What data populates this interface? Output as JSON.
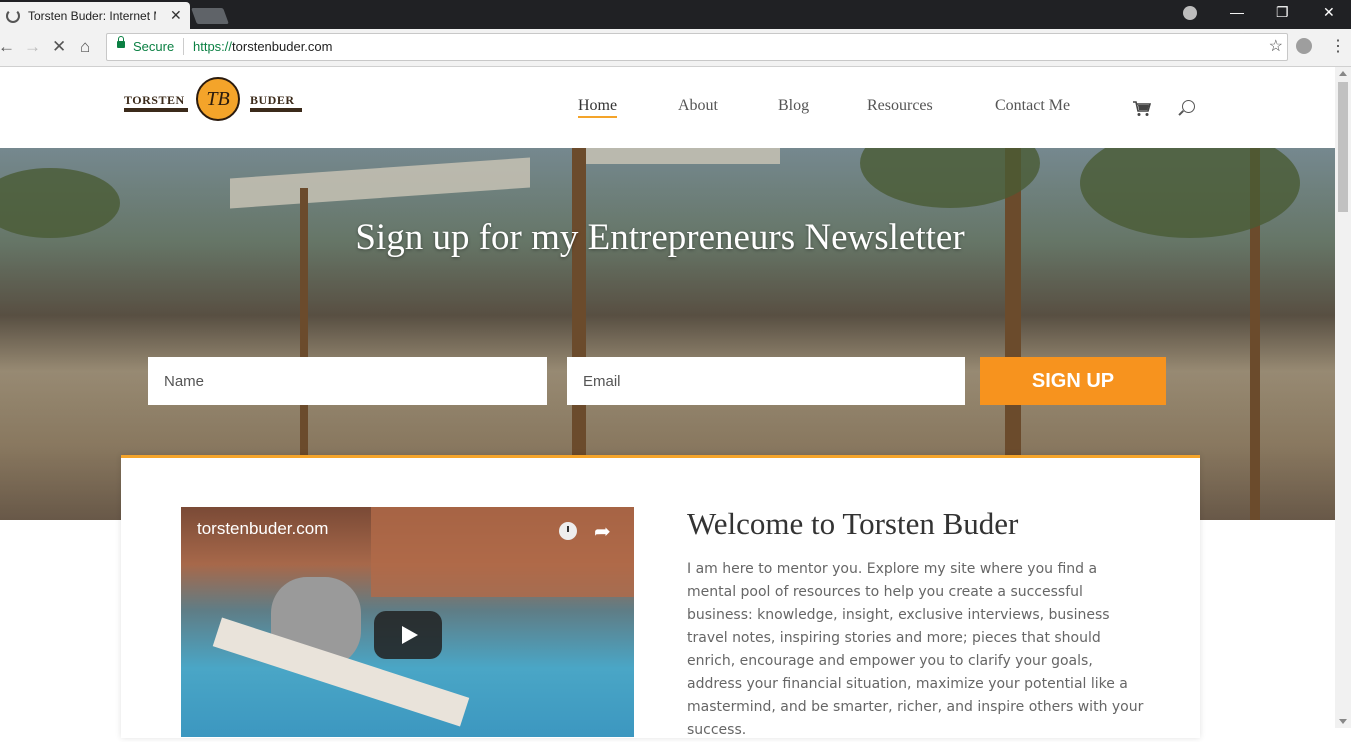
{
  "browser": {
    "tab_title": "Torsten Buder: Internet M",
    "tab_close": "✕",
    "secure_label": "Secure",
    "url_protocol": "https://",
    "url_host": "torstenbuder.com",
    "back_icon": "←",
    "forward_icon": "→",
    "stop_icon": "✕",
    "home_icon": "⌂",
    "star_icon": "☆",
    "menu_icon": "⋮",
    "min_icon": "—",
    "max_icon": "❐",
    "close_icon": "✕"
  },
  "site": {
    "logo_left": "TORSTEN",
    "logo_mark": "TB",
    "logo_right": "BUDER",
    "nav": [
      "Home",
      "About",
      "Blog",
      "Resources",
      "Contact Me"
    ],
    "active_nav": "Home",
    "accent_color": "#f4a42a"
  },
  "hero": {
    "heading": "Sign up for my Entrepreneurs Newsletter",
    "name_placeholder": "Name",
    "email_placeholder": "Email",
    "signup_label": "SIGN UP",
    "button_color": "#f7931e"
  },
  "welcome": {
    "video_title": "torstenbuder.com",
    "heading": "Welcome to Torsten Buder",
    "text": "I am here to mentor you. Explore my site where you find a mental pool of resources to help you create a successful business: knowledge, insight, exclusive interviews, business travel notes, inspiring stories and more; pieces that should enrich, encourage and empower you to clarify your goals, address your financial situation, maximize your potential like a mastermind, and be smarter, richer, and inspire others with your success."
  }
}
